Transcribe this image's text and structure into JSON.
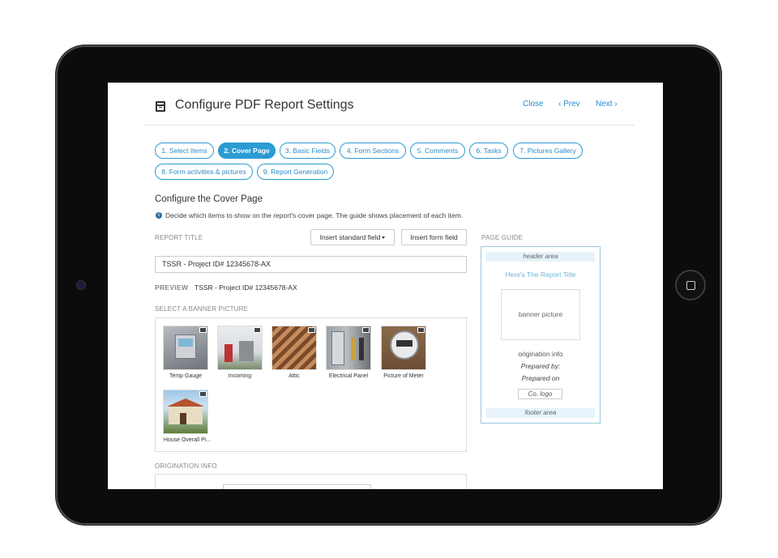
{
  "header": {
    "title": "Configure PDF Report Settings",
    "close_label": "Close",
    "prev_label": "‹ Prev",
    "next_label": "Next ›"
  },
  "steps": [
    {
      "label": "1. Select Items",
      "active": false
    },
    {
      "label": "2. Cover Page",
      "active": true
    },
    {
      "label": "3. Basic Fields",
      "active": false
    },
    {
      "label": "4. Form Sections",
      "active": false
    },
    {
      "label": "5. Comments",
      "active": false
    },
    {
      "label": "6. Tasks",
      "active": false
    },
    {
      "label": "7. Pictures Gallery",
      "active": false
    },
    {
      "label": "8. Form activities & pictures",
      "active": false
    },
    {
      "label": "9. Report Generation",
      "active": false
    }
  ],
  "section": {
    "title": "Configure the Cover Page",
    "info_icon": "i",
    "info": "Decide which items to show on the report's cover page. The guide shows placement of each item."
  },
  "report_title": {
    "label": "REPORT TITLE",
    "insert_standard_label": "Insert standard field",
    "insert_form_label": "Insert form field",
    "value": "TSSR - Project ID# 12345678-AX",
    "preview_label": "PREVIEW",
    "preview_value": "TSSR - Project ID# 12345678-AX"
  },
  "banner": {
    "label": "SELECT A BANNER PICTURE",
    "pictures": [
      {
        "caption": "Temp Gauge",
        "icon": "thermostat-photo"
      },
      {
        "caption": "Incoming",
        "icon": "mailbox-photo"
      },
      {
        "caption": "Attic",
        "icon": "attic-photo"
      },
      {
        "caption": "Electrical Panel",
        "icon": "electrical-panel-photo"
      },
      {
        "caption": "Picture of Meter",
        "icon": "meter-photo"
      },
      {
        "caption": "House Overall Pi...",
        "icon": "house-photo"
      }
    ]
  },
  "origination": {
    "label": "ORIGINATION INFO"
  },
  "page_guide": {
    "label": "PAGE GUIDE",
    "header_area": "header area",
    "report_title": "Here's The Report Title",
    "banner_picture": "banner picture",
    "origination_info": "origination info",
    "prepared_by": "Prepared by:",
    "prepared_on": "Prepared on",
    "company_logo": "Co. logo",
    "footer_area": "footer area"
  },
  "colors": {
    "accent": "#2b9bd3",
    "link": "#2b8bc6",
    "guide_band": "#e6f3fa",
    "bezel": "#0c0c0c"
  }
}
